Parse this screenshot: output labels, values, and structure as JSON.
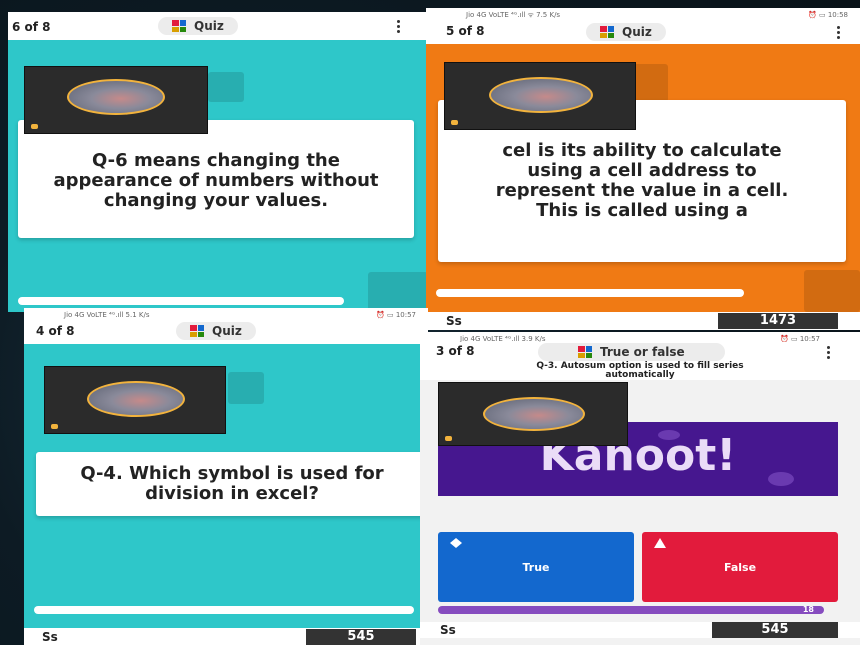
{
  "panels": {
    "p6": {
      "counter": "6 of 8",
      "mode": "Quiz",
      "question": "Q-6 means changing the appearance of numbers without changing your values.",
      "bg": "#2ec7c9"
    },
    "p5": {
      "status_left": "Jio 4G VoLTE ⁴ᴳ.ıll ᯤ 7.5 K/s",
      "status_right": "⏰ ▭ 10:58",
      "counter": "5 of 8",
      "mode": "Quiz",
      "question_visible": "cel is its ability to calculate using a cell address to represent the value in a cell. This is called using a",
      "nickname": "Ss",
      "score": "1473",
      "bg": "#f07a14"
    },
    "p4": {
      "status_left": "Jio 4G VoLTE ⁴ᴳ.ıll 5.1 K/s",
      "status_right": "⏰ ▭ 10:57",
      "counter": "4 of 8",
      "mode": "Quiz",
      "question": "Q-4. Which symbol is used for division in excel?",
      "nickname": "Ss",
      "score": "545",
      "bg": "#2ec7c9"
    },
    "p3": {
      "status_left": "Jio 4G VoLTE ⁴ᴳ.ıll 3.9 K/s",
      "status_right": "⏰ ▭ 10:57",
      "counter": "3 of 8",
      "mode": "True or false",
      "question": "Q-3. Autosum option is used to fill series automatically",
      "banner_word": "Kahoot!",
      "answer_true": "True",
      "answer_false": "False",
      "answer_count": "18",
      "nickname": "Ss",
      "score": "545"
    }
  },
  "colors": {
    "logo": [
      "#e21b3c",
      "#1368ce",
      "#d89e00",
      "#26890c"
    ],
    "true_blue": "#1368ce",
    "false_red": "#e21b3c",
    "purple": "#46178f",
    "bar_purple": "#864cbf"
  },
  "icons": {
    "logo": "kahoot-grid-icon",
    "menu": "kebab-menu-icon",
    "diamond": "diamond-icon",
    "triangle": "triangle-icon"
  }
}
